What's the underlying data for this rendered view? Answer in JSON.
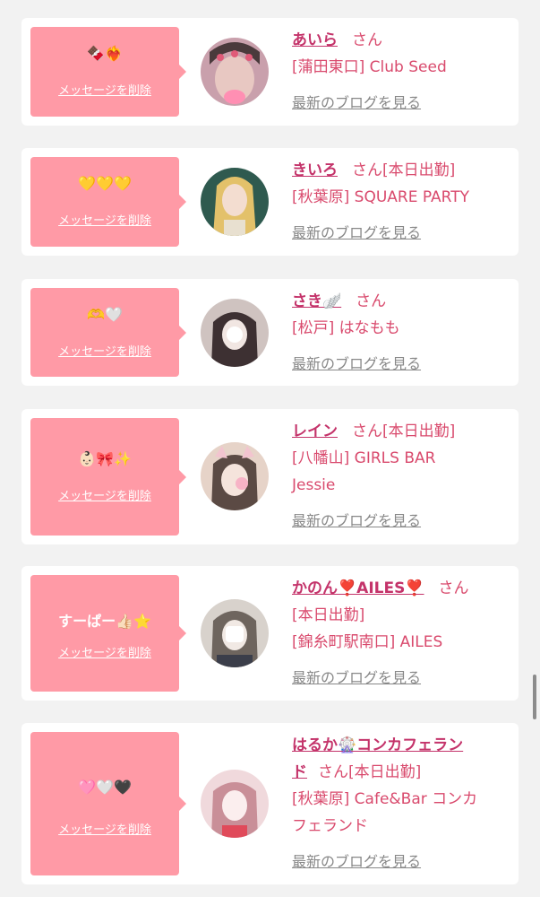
{
  "delete_label": "メッセージを削除",
  "blog_label": "最新のブログを見る",
  "san_label": "さん",
  "colors": {
    "bubble": "#ff9aa6",
    "name": "#c4336a",
    "text": "#d94a6d",
    "blog": "#888888"
  },
  "cards": [
    {
      "message": "🍫❤️‍🔥",
      "name": "あいら",
      "status": "",
      "shop": "[蒲田東口] Club Seed",
      "avatar_colors": [
        "#d9a9b3",
        "#4a3a3c"
      ]
    },
    {
      "message": "💛💛💛",
      "name": "きいろ",
      "status": "[本日出勤]",
      "shop": "[秋葉原] SQUARE PARTY",
      "avatar_colors": [
        "#e3c16a",
        "#2f5a4f"
      ]
    },
    {
      "message": "🫶🤍",
      "name": "さき🪽",
      "status": "",
      "shop": "[松戸] はなもも",
      "avatar_colors": [
        "#cfc3c0",
        "#3d3032"
      ]
    },
    {
      "message": "👶🏻🎀✨",
      "name": "レイン",
      "status": "[本日出勤]",
      "shop_line1": "[八幡山] GIRLS BAR",
      "shop_line2": "Jessie",
      "avatar_colors": [
        "#e6d3c8",
        "#5b4a44"
      ]
    },
    {
      "message": "すーぱー👍🏻⭐️",
      "name": "かのん❣️AILES❣️",
      "status": "[本日出勤]",
      "shop": "[錦糸町駅南口] AILES",
      "avatar_colors": [
        "#d8d2cc",
        "#6e655e"
      ]
    },
    {
      "message": "🩷🤍🖤",
      "name_line1": "はるか🎡コンカフェラン",
      "name_line2": "ド",
      "status": "[本日出勤]",
      "shop_line1": "[秋葉原] Cafe&Bar コンカ",
      "shop_line2": "フェランド",
      "avatar_colors": [
        "#f0d9dc",
        "#c98f98"
      ]
    }
  ]
}
